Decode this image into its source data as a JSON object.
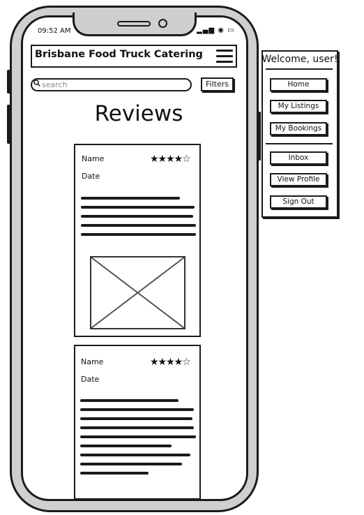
{
  "status_bar": {
    "time": "09:52 AM",
    "icons": "▂▄▆ ◉ ▭"
  },
  "header": {
    "title": "Brisbane Food Truck Catering",
    "menu_icon": "hamburger-icon"
  },
  "search": {
    "placeholder": "search",
    "value": "",
    "icon": "search-icon"
  },
  "filters_label": "Filters",
  "page_title": "Reviews",
  "reviews": [
    {
      "name_label": "Name",
      "date_label": "Date",
      "rating": 4.5,
      "stars": "★★★★☆"
    },
    {
      "name_label": "Name",
      "date_label": "Date",
      "rating": 4.5,
      "stars": "★★★★☆"
    }
  ],
  "menu": {
    "welcome": "Welcome, user!",
    "items": [
      {
        "label": "Home"
      },
      {
        "label": "My Listings"
      },
      {
        "label": "My Bookings"
      },
      {
        "label": "Inbox"
      },
      {
        "label": "View Profile"
      },
      {
        "label": "Sign Out"
      }
    ]
  }
}
